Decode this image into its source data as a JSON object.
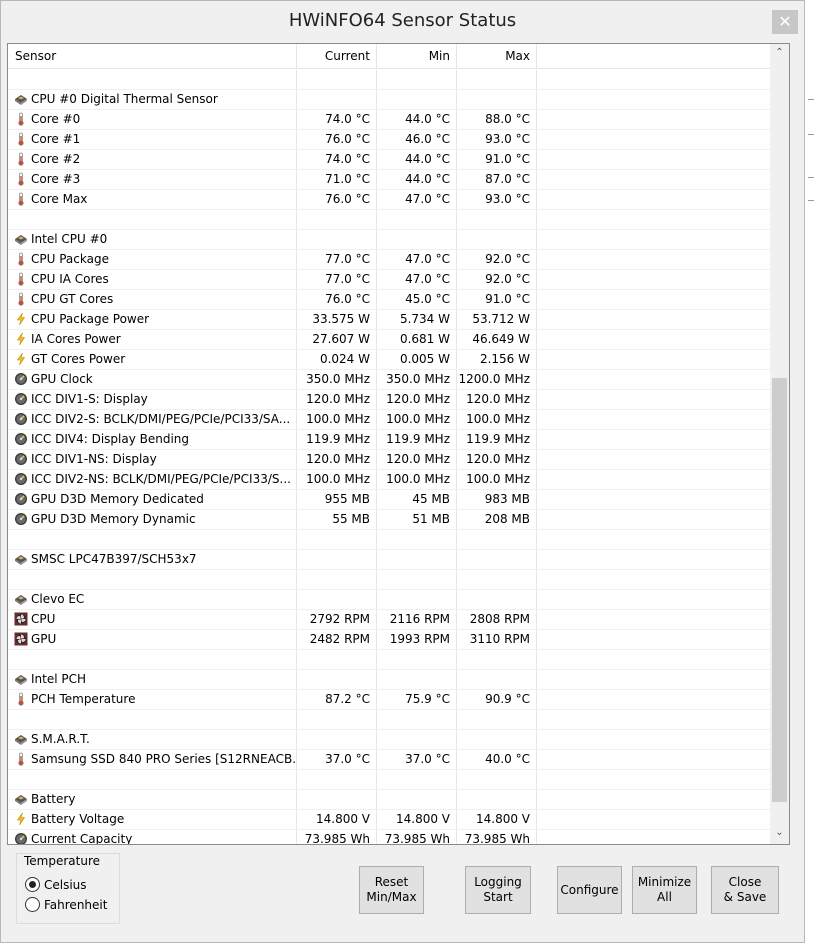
{
  "window": {
    "title": "HWiNFO64 Sensor Status",
    "close_glyph": "✕"
  },
  "columns": {
    "sensor": "Sensor",
    "current": "Current",
    "min": "Min",
    "max": "Max"
  },
  "rows": [
    {
      "type": "blank"
    },
    {
      "type": "header",
      "icon": "chip-icon",
      "name": "CPU #0 Digital Thermal Sensor",
      "current": "",
      "min": "",
      "max": ""
    },
    {
      "type": "sensor",
      "icon": "thermometer-icon",
      "name": "Core #0",
      "current": "74.0 °C",
      "min": "44.0 °C",
      "max": "88.0 °C"
    },
    {
      "type": "sensor",
      "icon": "thermometer-icon",
      "name": "Core #1",
      "current": "76.0 °C",
      "min": "46.0 °C",
      "max": "93.0 °C"
    },
    {
      "type": "sensor",
      "icon": "thermometer-icon",
      "name": "Core #2",
      "current": "74.0 °C",
      "min": "44.0 °C",
      "max": "91.0 °C"
    },
    {
      "type": "sensor",
      "icon": "thermometer-icon",
      "name": "Core #3",
      "current": "71.0 °C",
      "min": "44.0 °C",
      "max": "87.0 °C"
    },
    {
      "type": "sensor",
      "icon": "thermometer-icon",
      "name": "Core Max",
      "current": "76.0 °C",
      "min": "47.0 °C",
      "max": "93.0 °C"
    },
    {
      "type": "blank"
    },
    {
      "type": "header",
      "icon": "chip-icon",
      "name": "Intel CPU #0",
      "current": "",
      "min": "",
      "max": ""
    },
    {
      "type": "sensor",
      "icon": "thermometer-icon",
      "name": "CPU Package",
      "current": "77.0 °C",
      "min": "47.0 °C",
      "max": "92.0 °C"
    },
    {
      "type": "sensor",
      "icon": "thermometer-icon",
      "name": "CPU IA Cores",
      "current": "77.0 °C",
      "min": "47.0 °C",
      "max": "92.0 °C"
    },
    {
      "type": "sensor",
      "icon": "thermometer-icon",
      "name": "CPU GT Cores",
      "current": "76.0 °C",
      "min": "45.0 °C",
      "max": "91.0 °C"
    },
    {
      "type": "sensor",
      "icon": "lightning-icon",
      "name": "CPU Package Power",
      "current": "33.575 W",
      "min": "5.734 W",
      "max": "53.712 W"
    },
    {
      "type": "sensor",
      "icon": "lightning-icon",
      "name": "IA Cores Power",
      "current": "27.607 W",
      "min": "0.681 W",
      "max": "46.649 W"
    },
    {
      "type": "sensor",
      "icon": "lightning-icon",
      "name": "GT Cores Power",
      "current": "0.024 W",
      "min": "0.005 W",
      "max": "2.156 W"
    },
    {
      "type": "sensor",
      "icon": "gauge-icon",
      "name": "GPU Clock",
      "current": "350.0 MHz",
      "min": "350.0 MHz",
      "max": "1200.0 MHz"
    },
    {
      "type": "sensor",
      "icon": "gauge-icon",
      "name": "ICC DIV1-S: Display",
      "current": "120.0 MHz",
      "min": "120.0 MHz",
      "max": "120.0 MHz"
    },
    {
      "type": "sensor",
      "icon": "gauge-icon",
      "name": "ICC DIV2-S: BCLK/DMI/PEG/PCIe/PCI33/SA...",
      "current": "100.0 MHz",
      "min": "100.0 MHz",
      "max": "100.0 MHz"
    },
    {
      "type": "sensor",
      "icon": "gauge-icon",
      "name": "ICC DIV4: Display Bending",
      "current": "119.9 MHz",
      "min": "119.9 MHz",
      "max": "119.9 MHz"
    },
    {
      "type": "sensor",
      "icon": "gauge-icon",
      "name": "ICC DIV1-NS: Display",
      "current": "120.0 MHz",
      "min": "120.0 MHz",
      "max": "120.0 MHz"
    },
    {
      "type": "sensor",
      "icon": "gauge-icon",
      "name": "ICC DIV2-NS: BCLK/DMI/PEG/PCIe/PCI33/S...",
      "current": "100.0 MHz",
      "min": "100.0 MHz",
      "max": "100.0 MHz"
    },
    {
      "type": "sensor",
      "icon": "gauge-icon",
      "name": "GPU D3D Memory Dedicated",
      "current": "955 MB",
      "min": "45 MB",
      "max": "983 MB"
    },
    {
      "type": "sensor",
      "icon": "gauge-icon",
      "name": "GPU D3D Memory Dynamic",
      "current": "55 MB",
      "min": "51 MB",
      "max": "208 MB"
    },
    {
      "type": "blank"
    },
    {
      "type": "header",
      "icon": "chip-icon",
      "name": "SMSC LPC47B397/SCH53x7",
      "current": "",
      "min": "",
      "max": ""
    },
    {
      "type": "blank"
    },
    {
      "type": "header",
      "icon": "chip-icon",
      "name": "Clevo EC",
      "current": "",
      "min": "",
      "max": ""
    },
    {
      "type": "sensor",
      "icon": "fan-icon",
      "name": "CPU",
      "current": "2792 RPM",
      "min": "2116 RPM",
      "max": "2808 RPM"
    },
    {
      "type": "sensor",
      "icon": "fan-icon",
      "name": "GPU",
      "current": "2482 RPM",
      "min": "1993 RPM",
      "max": "3110 RPM"
    },
    {
      "type": "blank"
    },
    {
      "type": "header",
      "icon": "chip-icon",
      "name": "Intel PCH",
      "current": "",
      "min": "",
      "max": ""
    },
    {
      "type": "sensor",
      "icon": "thermometer-icon",
      "name": "PCH Temperature",
      "current": "87.2 °C",
      "min": "75.9 °C",
      "max": "90.9 °C"
    },
    {
      "type": "blank"
    },
    {
      "type": "header",
      "icon": "chip-icon",
      "name": "S.M.A.R.T.",
      "current": "",
      "min": "",
      "max": ""
    },
    {
      "type": "sensor",
      "icon": "thermometer-icon",
      "name": "Samsung SSD 840 PRO Series [S12RNEACB...",
      "current": "37.0 °C",
      "min": "37.0 °C",
      "max": "40.0 °C"
    },
    {
      "type": "blank"
    },
    {
      "type": "header",
      "icon": "chip-icon",
      "name": "Battery",
      "current": "",
      "min": "",
      "max": ""
    },
    {
      "type": "sensor",
      "icon": "lightning-icon",
      "name": "Battery Voltage",
      "current": "14.800 V",
      "min": "14.800 V",
      "max": "14.800 V"
    },
    {
      "type": "sensor",
      "icon": "gauge-icon",
      "name": "Current Capacity",
      "current": "73.985 Wh",
      "min": "73.985 Wh",
      "max": "73.985 Wh"
    }
  ],
  "scrollbar": {
    "up": "⌃",
    "down": "⌄"
  },
  "temperature": {
    "label": "Temperature",
    "options": [
      "Celsius",
      "Fahrenheit"
    ],
    "selected": "Celsius"
  },
  "buttons": {
    "reset": "Reset\nMin/Max",
    "logging": "Logging\nStart",
    "configure": "Configure",
    "minimize": "Minimize\nAll",
    "close": "Close\n& Save"
  }
}
